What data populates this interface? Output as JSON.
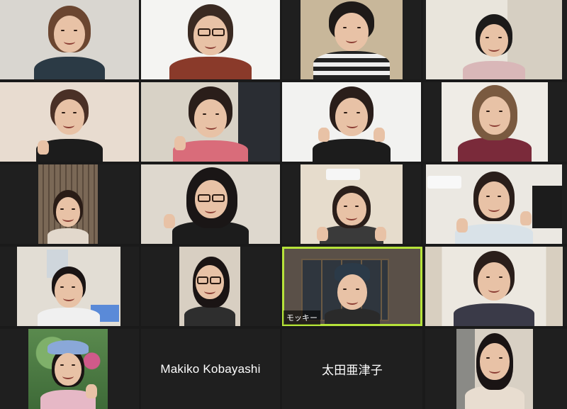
{
  "meeting": {
    "participants": [
      {
        "id": "p1",
        "name": ""
      },
      {
        "id": "p2",
        "name": ""
      },
      {
        "id": "p3",
        "name": ""
      },
      {
        "id": "p4",
        "name": ""
      },
      {
        "id": "p5",
        "name": ""
      },
      {
        "id": "p6",
        "name": ""
      },
      {
        "id": "p7",
        "name": ""
      },
      {
        "id": "p8",
        "name": ""
      },
      {
        "id": "p9",
        "name": ""
      },
      {
        "id": "p10",
        "name": ""
      },
      {
        "id": "p11",
        "name": ""
      },
      {
        "id": "p12",
        "name": ""
      },
      {
        "id": "p13",
        "name": ""
      },
      {
        "id": "p14",
        "name": ""
      },
      {
        "id": "p15",
        "name": "モッキー"
      },
      {
        "id": "p16",
        "name": ""
      },
      {
        "id": "p17",
        "name": ""
      },
      {
        "id": "p18",
        "name": "Makiko Kobayashi"
      },
      {
        "id": "p19",
        "name": "太田亜津子"
      },
      {
        "id": "p20",
        "name": ""
      }
    ],
    "active_speaker": "モッキー",
    "colors": {
      "active_border": "#b6e33a",
      "tile_background": "#1f1f1f",
      "gallery_background": "#1a1a1a"
    }
  }
}
